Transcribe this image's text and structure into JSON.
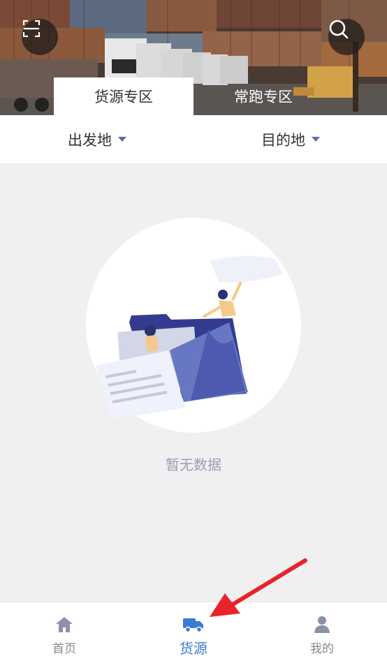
{
  "header": {
    "tabs": [
      {
        "label": "货源专区",
        "active": true
      },
      {
        "label": "常跑专区",
        "active": false
      }
    ],
    "left_icon": "scan-icon",
    "right_icon": "search-icon"
  },
  "filters": {
    "origin_label": "出发地",
    "destination_label": "目的地"
  },
  "empty_state": {
    "message": "暂无数据",
    "illustration": "empty-folder-illustration"
  },
  "bottom_nav": {
    "items": [
      {
        "label": "首页",
        "icon": "home-icon",
        "active": false
      },
      {
        "label": "货源",
        "icon": "truck-icon",
        "active": true
      },
      {
        "label": "我的",
        "icon": "person-icon",
        "active": false
      }
    ]
  },
  "colors": {
    "accent": "#3a7bd5",
    "annotation_arrow": "#e8242a",
    "background": "#f0f0f0"
  }
}
